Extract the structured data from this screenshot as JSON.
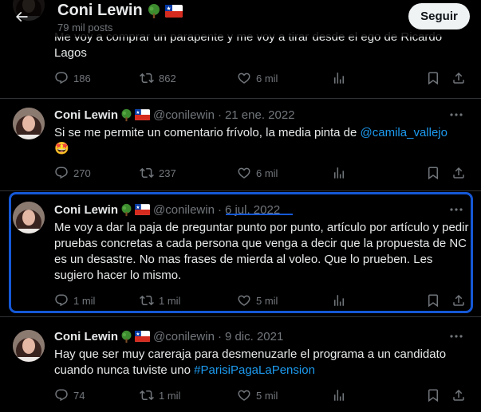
{
  "header": {
    "title": "Coni Lewin",
    "subtitle": "79 mil posts",
    "follow_label": "Seguir"
  },
  "tweets": [
    {
      "text": "Me voy a comprar un parapente y me voy a tirar desde el ego de Ricardo Lagos",
      "replies": "186",
      "retweets": "862",
      "likes": "6 mil"
    },
    {
      "name": "Coni Lewin",
      "handle": "@conilewin",
      "date": "21 ene. 2022",
      "text_before": "Si se me permite un comentario frívolo, la media pinta de ",
      "mention": "@camila_vallejo",
      "emoji": "🤩",
      "replies": "270",
      "retweets": "237",
      "likes": "6 mil"
    },
    {
      "name": "Coni Lewin",
      "handle": "@conilewin",
      "date": "6 jul. 2022",
      "text": "Me voy a dar la paja de preguntar punto por punto, artículo por artículo y pedir pruebas concretas a cada persona que venga a decir que la propuesta de NC es un desastre. No mas frases de mierda al voleo. Que lo prueben. Les sugiero hacer lo mismo.",
      "replies": "1 mil",
      "retweets": "1 mil",
      "likes": "5 mil"
    },
    {
      "name": "Coni Lewin",
      "handle": "@conilewin",
      "date": "9 dic. 2021",
      "text_before": "Hay que ser muy careraja para desmenuzarle el programa a un candidato cuando nunca tuviste uno ",
      "hashtag": "#ParisiPagaLaPension",
      "replies": "74",
      "retweets": "1 mil",
      "likes": "5 mil"
    }
  ],
  "icons": [
    "back-arrow-icon",
    "tree-emoji-icon",
    "chile-flag-icon",
    "reply-icon",
    "retweet-icon",
    "like-icon",
    "views-icon",
    "bookmark-icon",
    "share-icon",
    "more-icon"
  ],
  "colors": {
    "background": "#000000",
    "text": "#e7e9ea",
    "muted": "#71767b",
    "link": "#1d9bf0",
    "highlight": "#1558d6",
    "divider": "#2f3336"
  }
}
